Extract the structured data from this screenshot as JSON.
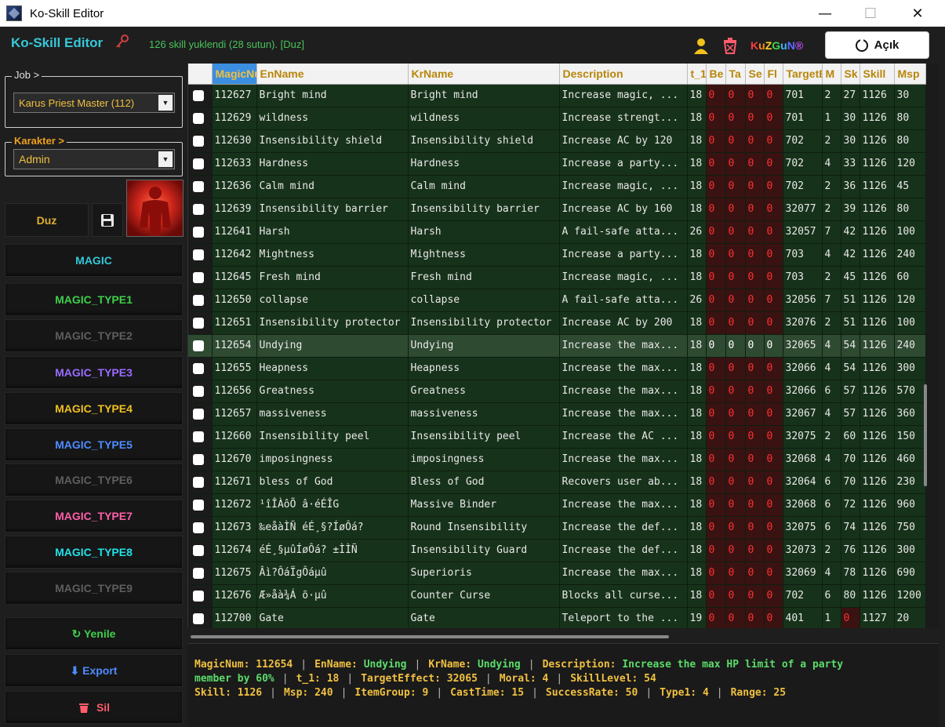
{
  "window": {
    "title": "Ko-Skill Editor",
    "minimize": "—",
    "maximize": "☐",
    "close": "✕"
  },
  "header": {
    "app_name": "Ko-Skill Editor",
    "status": "126 skill yuklendi (28 sutun). [Duz]",
    "brand": [
      "K",
      "u",
      "Z",
      "G",
      "u",
      "N",
      "®"
    ],
    "brand_colors": [
      "#ff3b3b",
      "#ff8c1a",
      "#ffd21f",
      "#3fd84a",
      "#39b8ff",
      "#5a6bff",
      "#c050ff"
    ],
    "open_button": "Açık"
  },
  "sidebar": {
    "job_legend": "Job >",
    "job_value": "Karus Priest Master (112)",
    "char_legend": "Karakter >",
    "char_value": "Admin",
    "duz_button": "Duz",
    "magic_buttons": [
      {
        "label": "MAGIC",
        "color": "#35c8d8"
      },
      {
        "label": "MAGIC_TYPE1",
        "color": "#3fcf4a"
      },
      {
        "label": "MAGIC_TYPE2",
        "color": "#5e5e5e"
      },
      {
        "label": "MAGIC_TYPE3",
        "color": "#9a6cff"
      },
      {
        "label": "MAGIC_TYPE4",
        "color": "#f0c020"
      },
      {
        "label": "MAGIC_TYPE5",
        "color": "#4d8cff"
      },
      {
        "label": "MAGIC_TYPE6",
        "color": "#5e5e5e"
      },
      {
        "label": "MAGIC_TYPE7",
        "color": "#ff5fa8"
      },
      {
        "label": "MAGIC_TYPE8",
        "color": "#22e0e8"
      },
      {
        "label": "MAGIC_TYPE9",
        "color": "#5e5e5e"
      }
    ],
    "refresh_button": "↻ Yenile",
    "export_button": "⬇ Export",
    "delete_button": "Sil"
  },
  "grid": {
    "columns": [
      "MagicNum",
      "EnName",
      "KrName",
      "Description",
      "t_1",
      "Be",
      "Ta",
      "Se",
      "Fl",
      "TargetEffect",
      "M",
      "Sk",
      "Skill",
      "Msp"
    ],
    "rows": [
      [
        "112627",
        "Bright mind",
        "Bright mind",
        "Increase magic, ...",
        "18",
        "0",
        "0",
        "0",
        "0",
        "701",
        "2",
        "27",
        "1126",
        "30"
      ],
      [
        "112629",
        "wildness",
        "wildness",
        "Increase strengt...",
        "18",
        "0",
        "0",
        "0",
        "0",
        "701",
        "1",
        "30",
        "1126",
        "80"
      ],
      [
        "112630",
        "Insensibility shield",
        "Insensibility shield",
        "Increase AC by 120",
        "18",
        "0",
        "0",
        "0",
        "0",
        "702",
        "2",
        "30",
        "1126",
        "80"
      ],
      [
        "112633",
        "Hardness",
        "Hardness",
        "Increase a party...",
        "18",
        "0",
        "0",
        "0",
        "0",
        "702",
        "4",
        "33",
        "1126",
        "120"
      ],
      [
        "112636",
        "Calm mind",
        "Calm mind",
        "Increase magic, ...",
        "18",
        "0",
        "0",
        "0",
        "0",
        "702",
        "2",
        "36",
        "1126",
        "45"
      ],
      [
        "112639",
        "Insensibility barrier",
        "Insensibility barrier",
        "Increase AC by 160",
        "18",
        "0",
        "0",
        "0",
        "0",
        "32077",
        "2",
        "39",
        "1126",
        "80"
      ],
      [
        "112641",
        "Harsh",
        "Harsh",
        "A fail-safe atta...",
        "26",
        "0",
        "0",
        "0",
        "0",
        "32057",
        "7",
        "42",
        "1126",
        "100"
      ],
      [
        "112642",
        "Mightness",
        "Mightness",
        "Increase a party...",
        "18",
        "0",
        "0",
        "0",
        "0",
        "703",
        "4",
        "42",
        "1126",
        "240"
      ],
      [
        "112645",
        "Fresh mind",
        "Fresh mind",
        "Increase magic, ...",
        "18",
        "0",
        "0",
        "0",
        "0",
        "703",
        "2",
        "45",
        "1126",
        "60"
      ],
      [
        "112650",
        "collapse",
        "collapse",
        "A fail-safe atta...",
        "26",
        "0",
        "0",
        "0",
        "0",
        "32056",
        "7",
        "51",
        "1126",
        "120"
      ],
      [
        "112651",
        "Insensibility protector",
        "Insensibility protector",
        "Increase AC by 200",
        "18",
        "0",
        "0",
        "0",
        "0",
        "32076",
        "2",
        "51",
        "1126",
        "100"
      ],
      [
        "112654",
        "Undying",
        "Undying",
        "Increase the max...",
        "18",
        "0",
        "0",
        "0",
        "0",
        "32065",
        "4",
        "54",
        "1126",
        "240"
      ],
      [
        "112655",
        "Heapness",
        "Heapness",
        "Increase the max...",
        "18",
        "0",
        "0",
        "0",
        "0",
        "32066",
        "4",
        "54",
        "1126",
        "300"
      ],
      [
        "112656",
        "Greatness",
        "Greatness",
        "Increase the max...",
        "18",
        "0",
        "0",
        "0",
        "0",
        "32066",
        "6",
        "57",
        "1126",
        "570"
      ],
      [
        "112657",
        "massiveness",
        "massiveness",
        "Increase the max...",
        "18",
        "0",
        "0",
        "0",
        "0",
        "32067",
        "4",
        "57",
        "1126",
        "360"
      ],
      [
        "112660",
        "Insensibility peel",
        "Insensibility peel",
        "Increase the AC ...",
        "18",
        "0",
        "0",
        "0",
        "0",
        "32075",
        "2",
        "60",
        "1126",
        "150"
      ],
      [
        "112670",
        "imposingness",
        "imposingness",
        "Increase the max...",
        "18",
        "0",
        "0",
        "0",
        "0",
        "32068",
        "4",
        "70",
        "1126",
        "460"
      ],
      [
        "112671",
        "bless of God",
        "Bless of God",
        "Recovers user ab...",
        "18",
        "0",
        "0",
        "0",
        "0",
        "32064",
        "6",
        "70",
        "1126",
        "230"
      ],
      [
        "112672",
        "¹îÎÀôÕ â·éÉÎG",
        "Massive Binder",
        "Increase the max...",
        "18",
        "0",
        "0",
        "0",
        "0",
        "32068",
        "6",
        "72",
        "1126",
        "960"
      ],
      [
        "112673",
        "‰eåàÌÑ éÉ¸§?ÍøÔá?",
        "Round Insensibility",
        "Increase the def...",
        "18",
        "0",
        "0",
        "0",
        "0",
        "32075",
        "6",
        "74",
        "1126",
        "750"
      ],
      [
        "112674",
        "éÉ¸§µûÍøÔá? ±ÌÌÑ",
        "Insensibility Guard",
        "Increase the def...",
        "18",
        "0",
        "0",
        "0",
        "0",
        "32073",
        "2",
        "76",
        "1126",
        "300"
      ],
      [
        "112675",
        "Âì?ÔáÏgÔáµû",
        "Superioris",
        "Increase the max...",
        "18",
        "0",
        "0",
        "0",
        "0",
        "32069",
        "4",
        "78",
        "1126",
        "690"
      ],
      [
        "112676",
        "Æ»åà¾Á õ·µû",
        "Counter Curse",
        "Blocks all curse...",
        "18",
        "0",
        "0",
        "0",
        "0",
        "702",
        "6",
        "80",
        "1126",
        "1200"
      ],
      [
        "112700",
        "Gate",
        "Gate",
        "Teleport to the ...",
        "19",
        "0",
        "0",
        "0",
        "0",
        "401",
        "1",
        "0",
        "1127",
        "20"
      ]
    ],
    "selected_row": 11
  },
  "detail": {
    "line1": [
      {
        "k": "MagicNum:",
        "v": "112654"
      },
      {
        "k": "EnName:",
        "v": "Undying"
      },
      {
        "k": "KrName:",
        "v": "Undying"
      },
      {
        "k": "Description:",
        "v": "Increase the max HP limit of a party"
      }
    ],
    "line2": [
      {
        "k": "",
        "v": "member by 60%"
      },
      {
        "k": "t_1:",
        "v": "18"
      },
      {
        "k": "TargetEffect:",
        "v": "32065"
      },
      {
        "k": "Moral:",
        "v": "4"
      },
      {
        "k": "SkillLevel:",
        "v": "54"
      }
    ],
    "line3": [
      {
        "k": "Skill:",
        "v": "1126"
      },
      {
        "k": "Msp:",
        "v": "240"
      },
      {
        "k": "ItemGroup:",
        "v": "9"
      },
      {
        "k": "CastTime:",
        "v": "15"
      },
      {
        "k": "SuccessRate:",
        "v": "50"
      },
      {
        "k": "Type1:",
        "v": "4"
      },
      {
        "k": "Range:",
        "v": "25"
      }
    ]
  }
}
